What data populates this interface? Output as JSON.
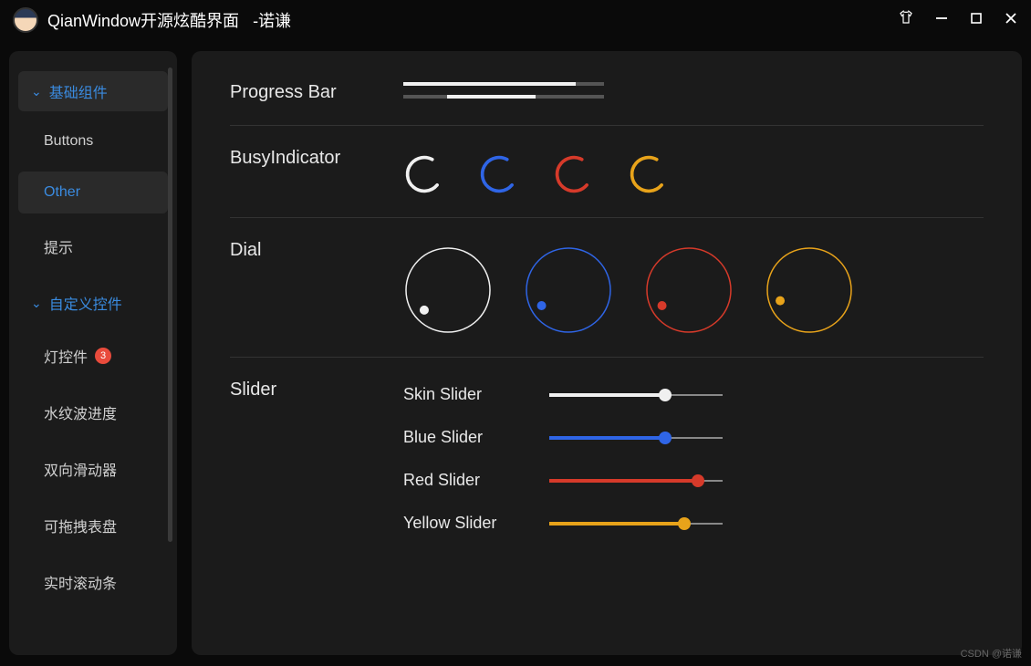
{
  "titlebar": {
    "app_title": "QianWindow开源炫酷界面",
    "author_tag": "-诺谦"
  },
  "sidebar": {
    "groups": [
      {
        "label": "基础组件",
        "boxed": true,
        "items": [
          {
            "label": "Buttons",
            "active": false
          },
          {
            "label": "Other",
            "active": true
          },
          {
            "label": "提示",
            "active": false
          }
        ]
      },
      {
        "label": "自定义控件",
        "boxed": false,
        "items": [
          {
            "label": "灯控件",
            "badge": "3"
          },
          {
            "label": "水纹波进度"
          },
          {
            "label": "双向滑动器"
          },
          {
            "label": "可拖拽表盘"
          },
          {
            "label": "实时滚动条"
          }
        ]
      }
    ]
  },
  "sections": {
    "progress": {
      "title": "Progress Bar",
      "bars": [
        {
          "fill_start": 0,
          "fill_width": 86
        },
        {
          "fill_start": 22,
          "fill_width": 44
        }
      ]
    },
    "busy": {
      "title": "BusyIndicator",
      "spinners": [
        {
          "color": "#f0f0f0"
        },
        {
          "color": "#2f65e6"
        },
        {
          "color": "#d63a2a"
        },
        {
          "color": "#e8a31a"
        }
      ]
    },
    "dial": {
      "title": "Dial",
      "dials": [
        {
          "stroke": "#f0f0f0",
          "dot": "#f0f0f0",
          "angle_deg": 220
        },
        {
          "stroke": "#2f65e6",
          "dot": "#2f65e6",
          "angle_deg": 210
        },
        {
          "stroke": "#d63a2a",
          "dot": "#d63a2a",
          "angle_deg": 210
        },
        {
          "stroke": "#e8a31a",
          "dot": "#e8a31a",
          "angle_deg": 200
        }
      ]
    },
    "slider": {
      "title": "Slider",
      "sliders": [
        {
          "label": "Skin Slider",
          "color": "#f0f0f0",
          "value": 67
        },
        {
          "label": "Blue Slider",
          "color": "#2f65e6",
          "value": 67
        },
        {
          "label": "Red Slider",
          "color": "#d63a2a",
          "value": 86
        },
        {
          "label": "Yellow Slider",
          "color": "#e8a31a",
          "value": 78
        }
      ]
    }
  },
  "watermark": "CSDN @诺谦"
}
